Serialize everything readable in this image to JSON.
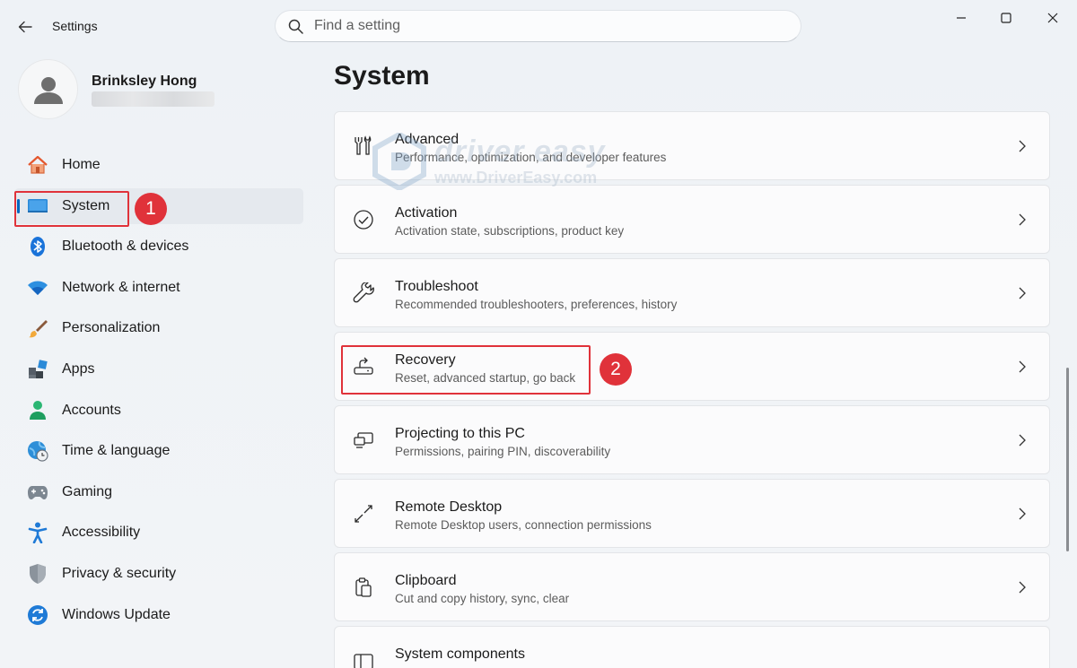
{
  "window": {
    "title": "Settings",
    "search_placeholder": "Find a setting"
  },
  "user": {
    "name": "Brinksley Hong"
  },
  "nav": {
    "items": [
      {
        "label": "Home",
        "icon": "home-icon"
      },
      {
        "label": "System",
        "icon": "system-icon",
        "active": true
      },
      {
        "label": "Bluetooth & devices",
        "icon": "bluetooth-icon"
      },
      {
        "label": "Network & internet",
        "icon": "wifi-icon"
      },
      {
        "label": "Personalization",
        "icon": "brush-icon"
      },
      {
        "label": "Apps",
        "icon": "apps-icon"
      },
      {
        "label": "Accounts",
        "icon": "accounts-icon"
      },
      {
        "label": "Time & language",
        "icon": "globe-clock-icon"
      },
      {
        "label": "Gaming",
        "icon": "gamepad-icon"
      },
      {
        "label": "Accessibility",
        "icon": "accessibility-icon"
      },
      {
        "label": "Privacy & security",
        "icon": "shield-icon"
      },
      {
        "label": "Windows Update",
        "icon": "update-icon"
      }
    ]
  },
  "main": {
    "title": "System",
    "cards": [
      {
        "title": "Advanced",
        "subtitle": "Performance, optimization, and developer features",
        "icon": "tools-icon"
      },
      {
        "title": "Activation",
        "subtitle": "Activation state, subscriptions, product key",
        "icon": "check-circle-icon"
      },
      {
        "title": "Troubleshoot",
        "subtitle": "Recommended troubleshooters, preferences, history",
        "icon": "wrench-icon"
      },
      {
        "title": "Recovery",
        "subtitle": "Reset, advanced startup, go back",
        "icon": "recovery-icon"
      },
      {
        "title": "Projecting to this PC",
        "subtitle": "Permissions, pairing PIN, discoverability",
        "icon": "project-icon"
      },
      {
        "title": "Remote Desktop",
        "subtitle": "Remote Desktop users, connection permissions",
        "icon": "remote-desktop-icon"
      },
      {
        "title": "Clipboard",
        "subtitle": "Cut and copy history, sync, clear",
        "icon": "clipboard-icon"
      },
      {
        "title": "System components",
        "subtitle": "",
        "icon": "components-icon"
      }
    ]
  },
  "annotations": {
    "step1": "1",
    "step2": "2"
  },
  "watermark": {
    "brand": "driver easy",
    "url": "www.DriverEasy.com"
  },
  "colors": {
    "accent": "#0067c0",
    "callout": "#e0323a"
  }
}
